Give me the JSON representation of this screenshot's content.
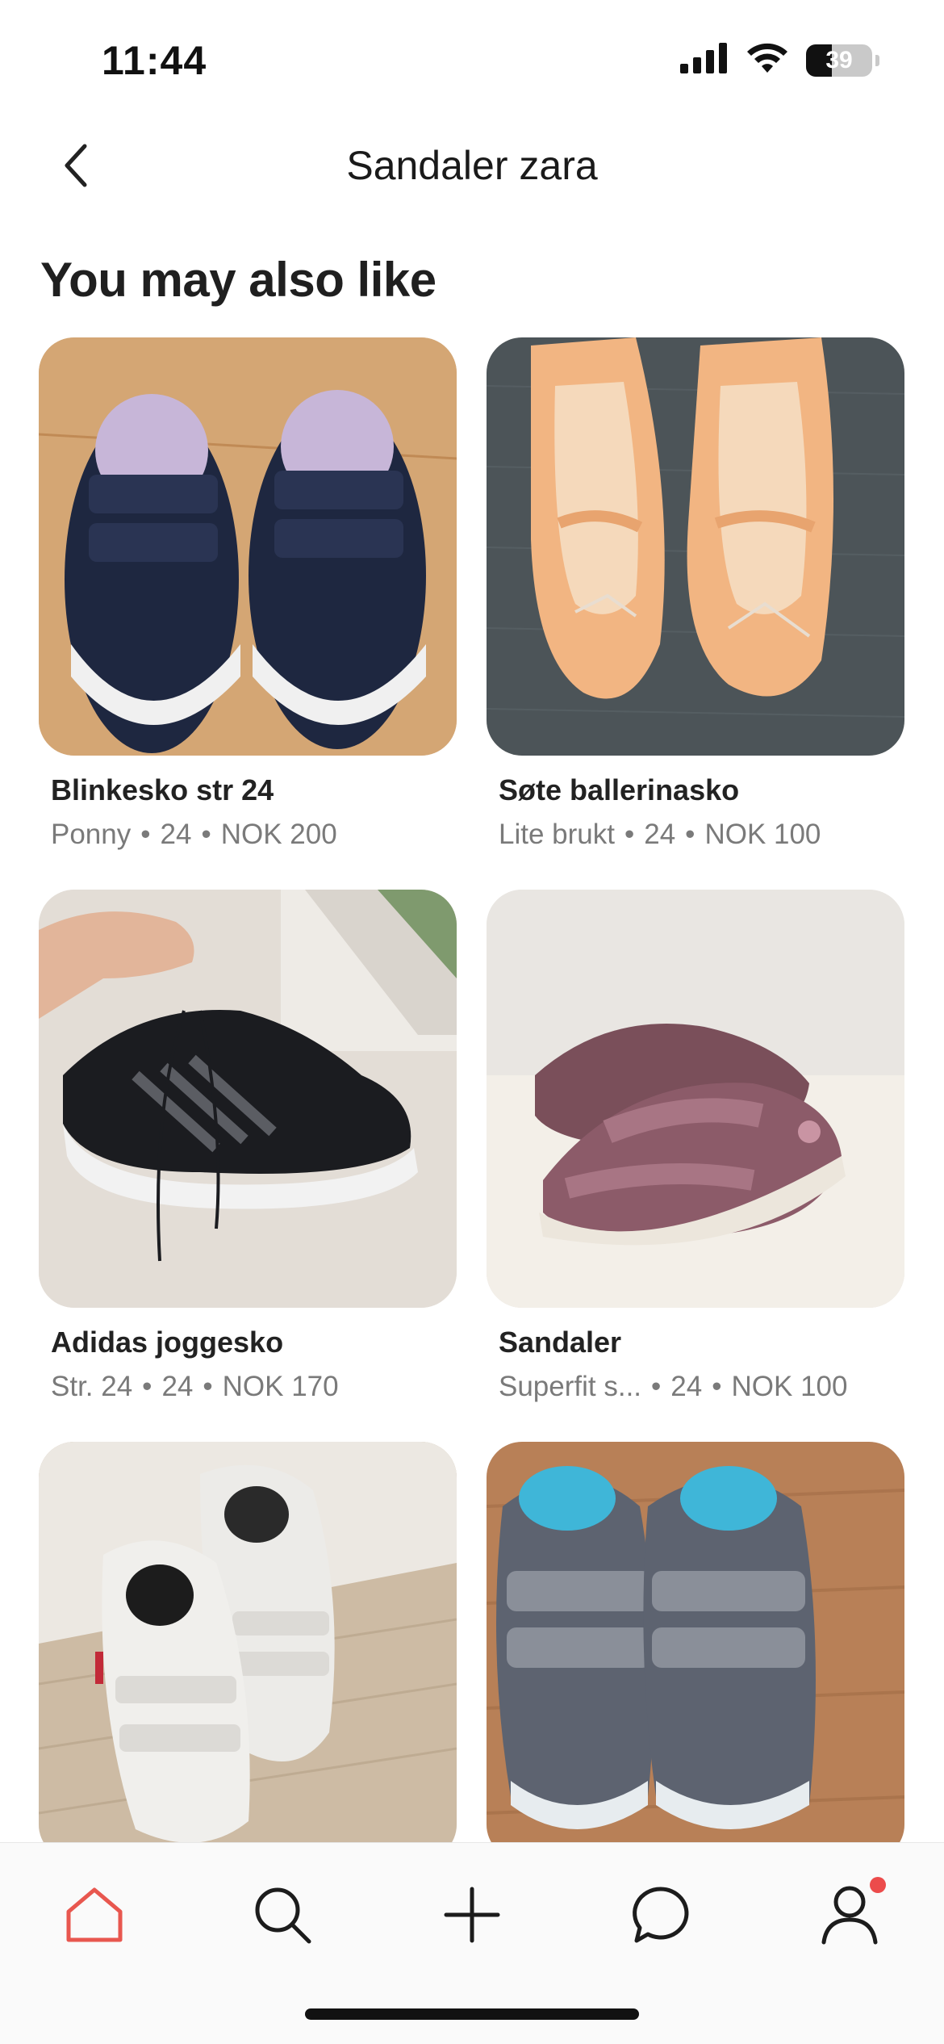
{
  "status_bar": {
    "time": "11:44",
    "battery_percent": "39",
    "battery_level": 0.39,
    "icons": [
      "signal-icon",
      "wifi-icon",
      "battery-icon"
    ]
  },
  "header": {
    "title": "Sandaler zara",
    "back_icon": "chevron-left-icon"
  },
  "section": {
    "title": "You may also like"
  },
  "listings": [
    {
      "title": "Blinkesko str 24",
      "brand": "Ponny",
      "size": "24",
      "price": "NOK 200",
      "image": "navy-velcro-sneakers"
    },
    {
      "title": "Søte ballerinasko",
      "brand": "Lite brukt",
      "size": "24",
      "price": "NOK 100",
      "image": "peach-ballerina-shoes"
    },
    {
      "title": "Adidas joggesko",
      "brand": "Str. 24",
      "size": "24",
      "price": "NOK 170",
      "image": "black-adidas-sneakers"
    },
    {
      "title": "Sandaler",
      "brand": "Superfit s...",
      "size": "24",
      "price": "NOK 100",
      "image": "mauve-closed-toe-sandals"
    },
    {
      "title": "",
      "brand": "",
      "size": "",
      "price": "",
      "image": "white-adidas-velcro-sneakers"
    },
    {
      "title": "",
      "brand": "",
      "size": "",
      "price": "",
      "image": "grey-blue-velcro-sneakers"
    }
  ],
  "separator": "•",
  "tab_bar": {
    "tabs": [
      "home-icon",
      "search-icon",
      "add-icon",
      "messages-icon",
      "profile-icon"
    ],
    "active": "home-icon",
    "accent_color": "#e8574f",
    "notification_color": "#ec4b4b"
  }
}
